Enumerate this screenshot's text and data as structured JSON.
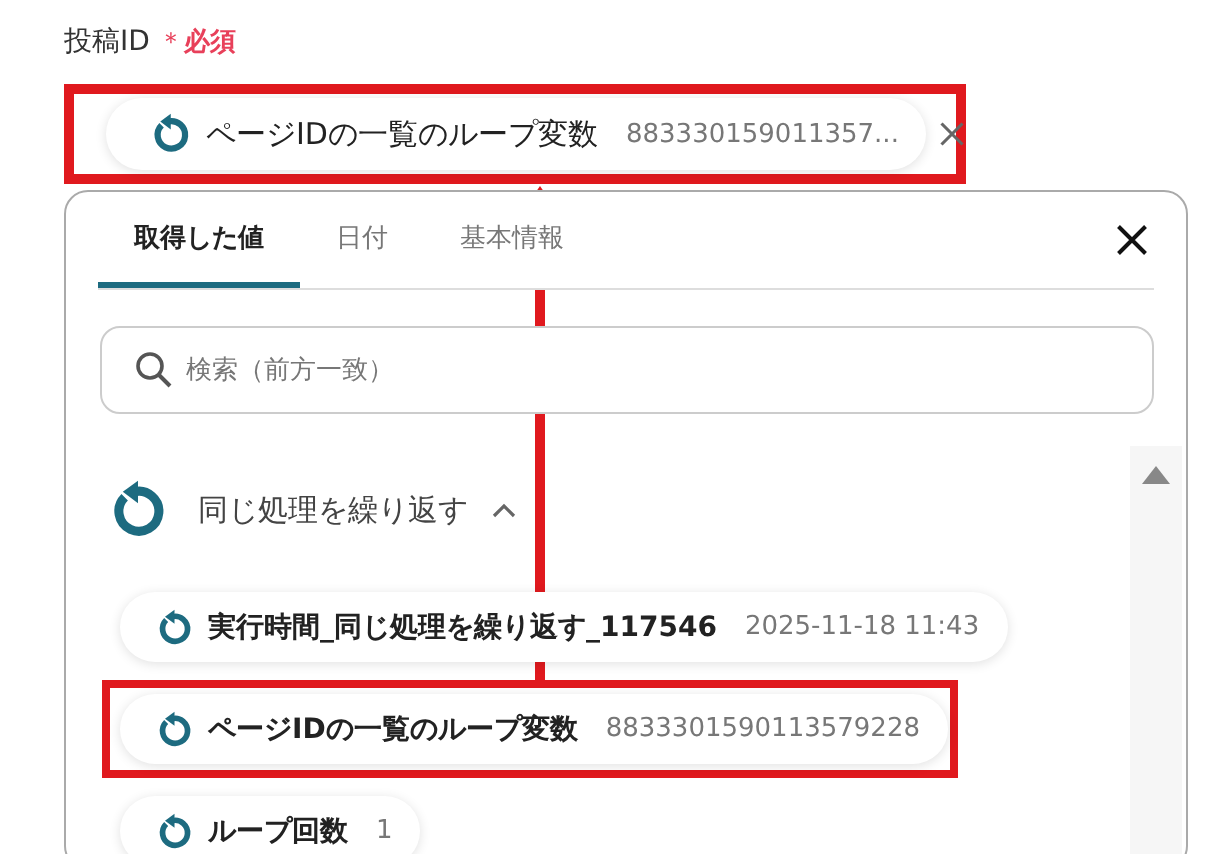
{
  "field": {
    "label": "投稿ID",
    "required_mark": "＊",
    "required_text": "必須",
    "highlighted": true,
    "chip": {
      "name": "ページIDの一覧のループ変数",
      "value": "883330159011357..."
    }
  },
  "panel": {
    "tabs": [
      {
        "label": "取得した値",
        "selected": true
      },
      {
        "label": "日付",
        "selected": false
      },
      {
        "label": "基本情報",
        "selected": false
      }
    ],
    "search": {
      "placeholder": "検索（前方一致）"
    },
    "group": {
      "title": "同じ処理を繰り返す",
      "expanded": true,
      "items": [
        {
          "name": "実行時間_同じ処理を繰り返す_117546",
          "value": "2025-11-18 11:43",
          "highlighted": false
        },
        {
          "name": "ページIDの一覧のループ変数",
          "value": "8833301590113579228",
          "highlighted": true
        },
        {
          "name": "ループ回数",
          "value": "1",
          "highlighted": false
        }
      ]
    }
  }
}
